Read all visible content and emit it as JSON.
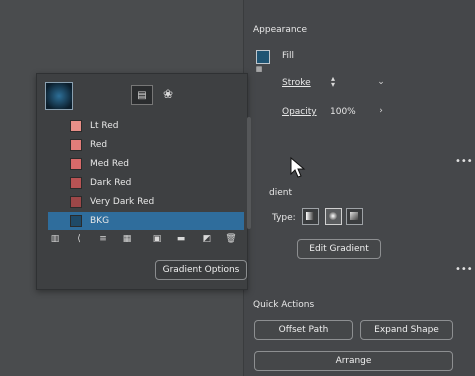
{
  "appearance": {
    "title": "Appearance",
    "fill_label": "Fill",
    "stroke_label": "Stroke",
    "opacity_label": "Opacity",
    "opacity_value": "100%",
    "more": "•••"
  },
  "gradient": {
    "title": "dient",
    "type_label": "Type:",
    "edit_button": "Edit Gradient",
    "more": "•••"
  },
  "swatches": {
    "items": [
      {
        "label": "Lt Red",
        "color": "#e88f88"
      },
      {
        "label": "Red",
        "color": "#e27d7a"
      },
      {
        "label": "Med Red",
        "color": "#d86a6a"
      },
      {
        "label": "Dark Red",
        "color": "#b85354"
      },
      {
        "label": "Very Dark Red",
        "color": "#9c4748"
      },
      {
        "label": "BKG",
        "color": "#1f4a68"
      }
    ],
    "gradient_options_button": "Gradient Options"
  },
  "quick_actions": {
    "title": "Quick Actions",
    "offset_path": "Offset Path",
    "expand_shape": "Expand Shape",
    "arrange": "Arrange"
  },
  "colors": {
    "selected_row": "#2f6d9c",
    "fill": "#1f5473"
  }
}
